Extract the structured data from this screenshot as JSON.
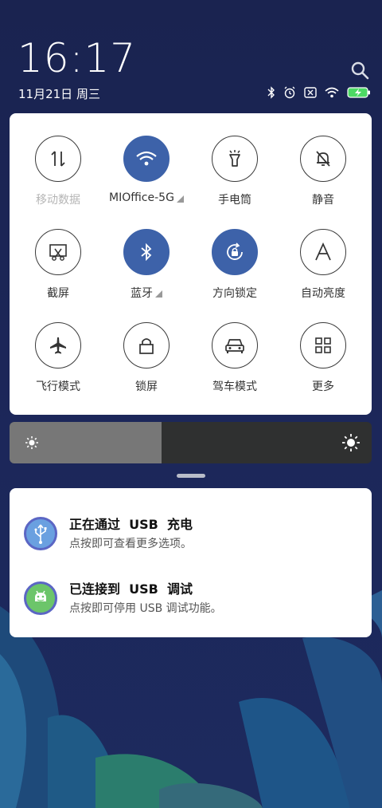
{
  "status_bar": {
    "time": "16:17",
    "date": "11月21日 周三"
  },
  "status_icons": [
    "bluetooth-icon",
    "alarm-icon",
    "no-sim-icon",
    "wifi-icon",
    "battery-charging-icon"
  ],
  "toggles": [
    {
      "label": "移动数据",
      "icon": "mobile-data-icon",
      "active": false,
      "disabled": true
    },
    {
      "label": "MIOffice-5G",
      "icon": "wifi-icon",
      "active": true,
      "expandable": true
    },
    {
      "label": "手电筒",
      "icon": "flashlight-icon",
      "active": false
    },
    {
      "label": "静音",
      "icon": "mute-bell-icon",
      "active": false
    },
    {
      "label": "截屏",
      "icon": "screenshot-icon",
      "active": false
    },
    {
      "label": "蓝牙",
      "icon": "bluetooth-icon",
      "active": true,
      "expandable": true
    },
    {
      "label": "方向锁定",
      "icon": "rotation-lock-icon",
      "active": true
    },
    {
      "label": "自动亮度",
      "icon": "auto-brightness-icon",
      "active": false
    },
    {
      "label": "飞行模式",
      "icon": "airplane-icon",
      "active": false
    },
    {
      "label": "锁屏",
      "icon": "lock-icon",
      "active": false
    },
    {
      "label": "驾车模式",
      "icon": "car-icon",
      "active": false
    },
    {
      "label": "更多",
      "icon": "grid-icon",
      "active": false
    }
  ],
  "brightness": {
    "level": 0.42
  },
  "notifications": [
    {
      "title": "正在通过  USB  充电",
      "text": "点按即可查看更多选项。",
      "icon": "usb-icon",
      "icon_color": "#6aa0e0"
    },
    {
      "title": "已连接到  USB  调试",
      "text": "点按即可停用 USB 调试功能。",
      "icon": "android-icon",
      "icon_color": "#6cc56a"
    }
  ],
  "colors": {
    "accent": "#3d62a9",
    "panel": "#ffffff",
    "background": "#1c275a"
  }
}
